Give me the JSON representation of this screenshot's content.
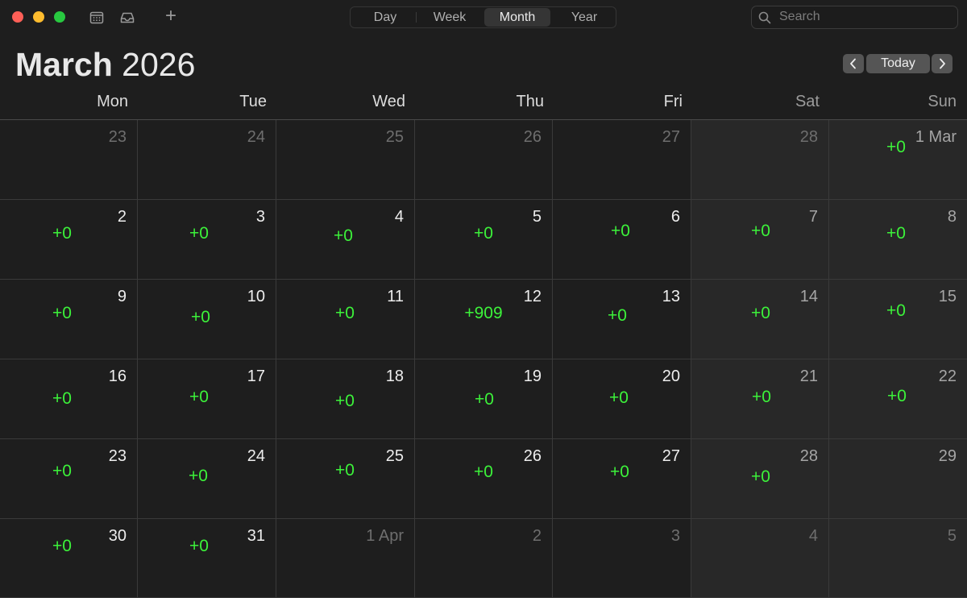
{
  "toolbar": {
    "views": [
      "Day",
      "Week",
      "Month",
      "Year"
    ],
    "active_view": "Month",
    "search_placeholder": "Search"
  },
  "header": {
    "month": "March",
    "year": "2026",
    "today_label": "Today"
  },
  "weekdays": [
    "Mon",
    "Tue",
    "Wed",
    "Thu",
    "Fri",
    "Sat",
    "Sun"
  ],
  "weeks": [
    [
      {
        "day": "23",
        "other": true,
        "count": ""
      },
      {
        "day": "24",
        "other": true,
        "count": ""
      },
      {
        "day": "25",
        "other": true,
        "count": ""
      },
      {
        "day": "26",
        "other": true,
        "count": ""
      },
      {
        "day": "27",
        "other": true,
        "count": ""
      },
      {
        "day": "28",
        "other": true,
        "count": ""
      },
      {
        "day": "1 Mar",
        "other": false,
        "count": "+0"
      }
    ],
    [
      {
        "day": "2",
        "other": false,
        "count": "+0"
      },
      {
        "day": "3",
        "other": false,
        "count": "+0"
      },
      {
        "day": "4",
        "other": false,
        "count": "+0"
      },
      {
        "day": "5",
        "other": false,
        "count": "+0"
      },
      {
        "day": "6",
        "other": false,
        "count": "+0"
      },
      {
        "day": "7",
        "other": false,
        "count": "+0"
      },
      {
        "day": "8",
        "other": false,
        "count": "+0"
      }
    ],
    [
      {
        "day": "9",
        "other": false,
        "count": "+0"
      },
      {
        "day": "10",
        "other": false,
        "count": "+0"
      },
      {
        "day": "11",
        "other": false,
        "count": "+0"
      },
      {
        "day": "12",
        "other": false,
        "count": "+909"
      },
      {
        "day": "13",
        "other": false,
        "count": "+0"
      },
      {
        "day": "14",
        "other": false,
        "count": "+0"
      },
      {
        "day": "15",
        "other": false,
        "count": "+0"
      }
    ],
    [
      {
        "day": "16",
        "other": false,
        "count": "+0"
      },
      {
        "day": "17",
        "other": false,
        "count": "+0"
      },
      {
        "day": "18",
        "other": false,
        "count": "+0"
      },
      {
        "day": "19",
        "other": false,
        "count": "+0"
      },
      {
        "day": "20",
        "other": false,
        "count": "+0"
      },
      {
        "day": "21",
        "other": false,
        "count": "+0"
      },
      {
        "day": "22",
        "other": false,
        "count": "+0"
      }
    ],
    [
      {
        "day": "23",
        "other": false,
        "count": "+0"
      },
      {
        "day": "24",
        "other": false,
        "count": "+0"
      },
      {
        "day": "25",
        "other": false,
        "count": "+0"
      },
      {
        "day": "26",
        "other": false,
        "count": "+0"
      },
      {
        "day": "27",
        "other": false,
        "count": "+0"
      },
      {
        "day": "28",
        "other": false,
        "count": "+0"
      },
      {
        "day": "29",
        "other": false,
        "count": ""
      }
    ],
    [
      {
        "day": "30",
        "other": false,
        "count": "+0"
      },
      {
        "day": "31",
        "other": false,
        "count": "+0"
      },
      {
        "day": "1 Apr",
        "other": true,
        "count": ""
      },
      {
        "day": "2",
        "other": true,
        "count": ""
      },
      {
        "day": "3",
        "other": true,
        "count": ""
      },
      {
        "day": "4",
        "other": true,
        "count": ""
      },
      {
        "day": "5",
        "other": true,
        "count": ""
      }
    ]
  ],
  "colors": {
    "count_text": "#3cf23a",
    "background": "#1e1e1e",
    "weekend_background": "#282828"
  }
}
